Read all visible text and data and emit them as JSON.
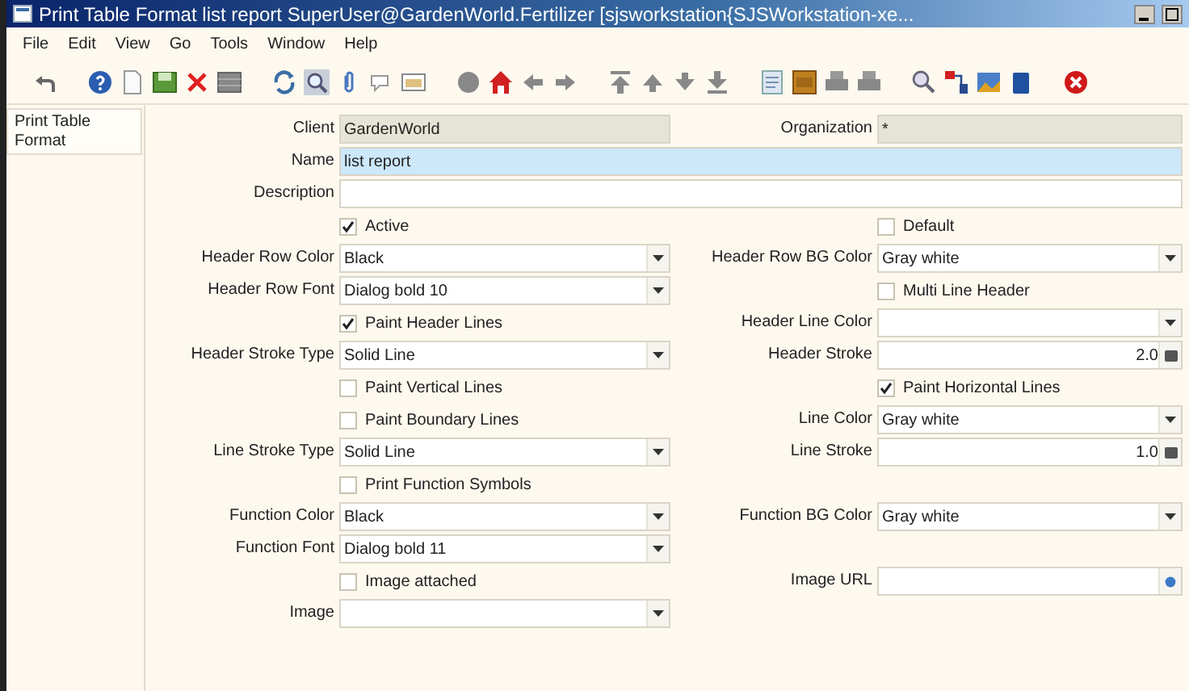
{
  "window": {
    "title": "Print Table Format  list report  SuperUser@GardenWorld.Fertilizer [sjsworkstation{SJSWorkstation-xe..."
  },
  "menu": [
    "File",
    "Edit",
    "View",
    "Go",
    "Tools",
    "Window",
    "Help"
  ],
  "tabs": [
    {
      "label": "Print Table Format",
      "selected": true
    }
  ],
  "form": [
    {
      "left": {
        "kind": "text",
        "label": "Client",
        "value": "GardenWorld",
        "disabled": true,
        "focused": false
      },
      "right": {
        "kind": "text",
        "label": "Organization",
        "value": "*",
        "disabled": true,
        "focused": false
      }
    },
    {
      "full": {
        "kind": "text",
        "label": "Name",
        "value": "list report",
        "disabled": false,
        "focused": true
      }
    },
    {
      "full": {
        "kind": "text",
        "label": "Description",
        "disabled": false,
        "focused": false
      }
    },
    {
      "left": {
        "kind": "checkbox",
        "label": "Active",
        "checked": true
      },
      "right": {
        "kind": "checkbox",
        "label": "Default",
        "checked": false
      }
    },
    {
      "left": {
        "kind": "combo",
        "label": "Header Row Color",
        "value": "Black",
        "disabled": false,
        "focused": false
      },
      "right": {
        "kind": "combo",
        "label": "Header Row BG Color",
        "value": "Gray white",
        "disabled": false,
        "focused": false
      }
    },
    {
      "left": {
        "kind": "combo",
        "label": "Header Row Font",
        "value": "Dialog bold 10",
        "disabled": false,
        "focused": false
      },
      "right": {
        "kind": "checkbox",
        "label": "Multi Line Header",
        "checked": false
      }
    },
    {
      "left": {
        "kind": "checkbox",
        "label": "Paint Header Lines",
        "checked": true
      },
      "right": {
        "kind": "combo",
        "label": "Header Line Color",
        "disabled": false,
        "focused": false
      }
    },
    {
      "left": {
        "kind": "combo",
        "label": "Header Stroke Type",
        "value": "Solid Line",
        "disabled": false,
        "focused": false
      },
      "right": {
        "kind": "number",
        "label": "Header Stroke",
        "value": "2.0",
        "disabled": false,
        "focused": false
      }
    },
    {
      "left": {
        "kind": "checkbox",
        "label": "Paint Vertical Lines",
        "checked": false
      },
      "right": {
        "kind": "checkbox",
        "label": "Paint Horizontal Lines",
        "checked": true
      }
    },
    {
      "left": {
        "kind": "checkbox",
        "label": "Paint Boundary Lines",
        "checked": false
      },
      "right": {
        "kind": "combo",
        "label": "Line Color",
        "value": "Gray white",
        "disabled": false,
        "focused": false
      }
    },
    {
      "left": {
        "kind": "combo",
        "label": "Line Stroke Type",
        "value": "Solid Line",
        "disabled": false,
        "focused": false
      },
      "right": {
        "kind": "number",
        "label": "Line Stroke",
        "value": "1.0",
        "disabled": false,
        "focused": false
      }
    },
    {
      "left": {
        "kind": "checkbox",
        "label": "Print Function Symbols",
        "checked": false
      }
    },
    {
      "left": {
        "kind": "combo",
        "label": "Function Color",
        "value": "Black",
        "disabled": false,
        "focused": false
      },
      "right": {
        "kind": "combo",
        "label": "Function BG Color",
        "value": "Gray white",
        "disabled": false,
        "focused": false
      }
    },
    {
      "left": {
        "kind": "combo",
        "label": "Function Font",
        "value": "Dialog bold 11",
        "disabled": false,
        "focused": false
      }
    },
    {
      "left": {
        "kind": "checkbox",
        "label": "Image attached",
        "checked": false
      },
      "right": {
        "kind": "url",
        "label": "Image URL",
        "disabled": false,
        "focused": false
      }
    },
    {
      "left": {
        "kind": "combo",
        "label": "Image",
        "disabled": false,
        "focused": false
      }
    }
  ]
}
